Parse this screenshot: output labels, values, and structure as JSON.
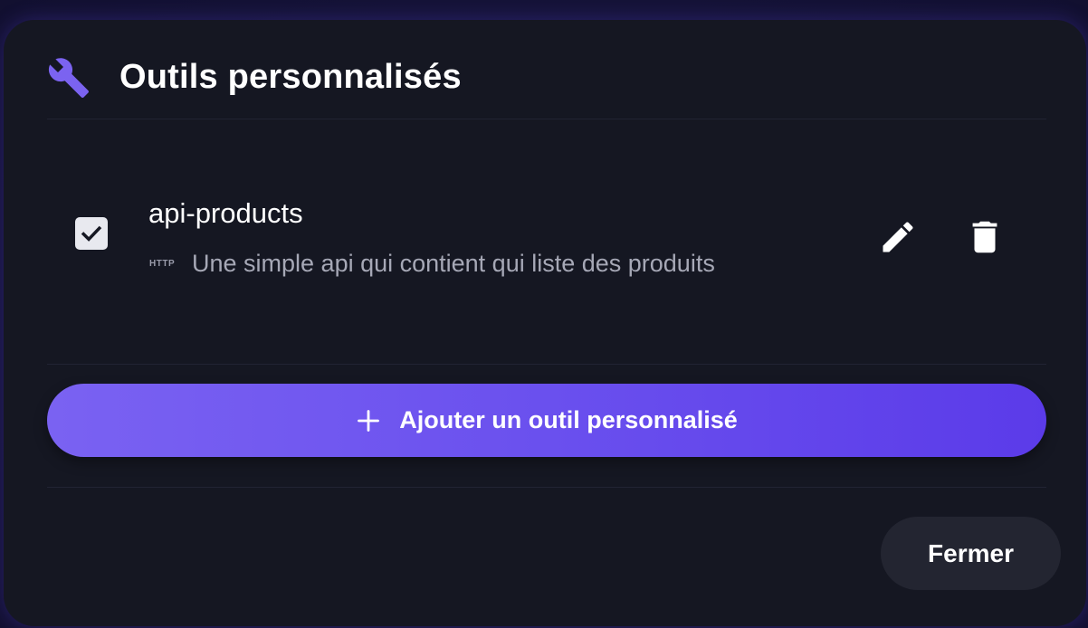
{
  "dialog": {
    "title": "Outils personnalisés",
    "icon": "wrench-icon"
  },
  "tools": [
    {
      "name": "api-products",
      "type": "HTTP",
      "description": "Une simple api qui contient qui liste des produits",
      "enabled": true,
      "actions": [
        "edit-icon",
        "trash-icon"
      ]
    }
  ],
  "add_button": {
    "label": "Ajouter un outil personnalisé",
    "icon": "plus-icon"
  },
  "close_button": {
    "label": "Fermer"
  },
  "colors": {
    "accent": "#6c54ef",
    "dialog_background": "#151722",
    "text_primary": "#ffffff",
    "text_secondary": "#a6a8b6"
  }
}
